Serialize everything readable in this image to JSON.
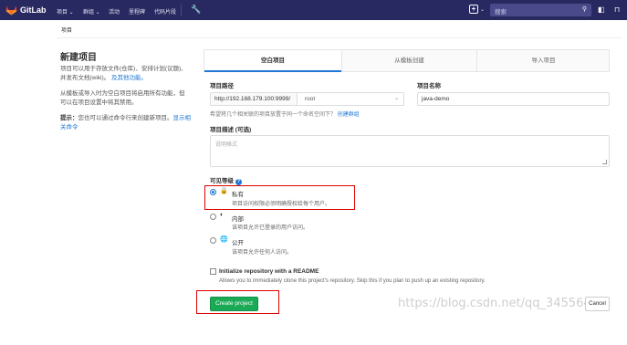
{
  "topbar": {
    "brand": "GitLab",
    "nav": [
      "项目 ⌄",
      "群组 ⌄",
      "活动",
      "里程碑",
      "代码片段"
    ],
    "search_placeholder": "搜索"
  },
  "breadcrumb": "项目",
  "left": {
    "title": "新建项目",
    "intro": "项目可以用于存放文件(仓库)、安排计划(议题)、并发布文档(wiki)。",
    "intro_link": "及其他功能。",
    "intro2": "从模板或导入时为空白项目将启用所有功能，但可以在项目设置中将其禁用。",
    "tip_label": "提示：",
    "tip_text": "您也可以通过命令行来创建新项目。",
    "tip_link": "显示相关命令"
  },
  "tabs": [
    "空白项目",
    "从模板创建",
    "导入项目"
  ],
  "form": {
    "path_label": "项目路径",
    "url_prefix": "http://192.168.179.100:9999/",
    "namespace": "root",
    "name_label": "项目名称",
    "name_value": "java-demo",
    "help": "希望将几个相关联的项目放置于同一个命名空间下？",
    "help_link": "创建群组",
    "desc_label": "项目描述 (可选)",
    "desc_placeholder": "说明格式",
    "visibility_label": "可见等级",
    "visibility": [
      {
        "title": "私有",
        "desc": "项目访问权限必须明确授权给每个用户。",
        "icon": "lock-icon",
        "selected": true
      },
      {
        "title": "内部",
        "desc": "该项目允许已登录的用户访问。",
        "icon": "shield-icon",
        "selected": false
      },
      {
        "title": "公开",
        "desc": "该项目允许任何人访问。",
        "icon": "globe-icon",
        "selected": false
      }
    ],
    "readme_title": "Initialize repository with a README",
    "readme_desc": "Allows you to immediately clone this project's repository. Skip this if you plan to push up an existing repository.",
    "create_label": "Create project",
    "cancel_label": "Cancel"
  },
  "watermark": "https://blog.csdn.net/qq_34556414",
  "colors": {
    "nav": "#292961",
    "primary": "#1f78d1",
    "create": "#1aaa55",
    "highlight": "#e00000"
  }
}
